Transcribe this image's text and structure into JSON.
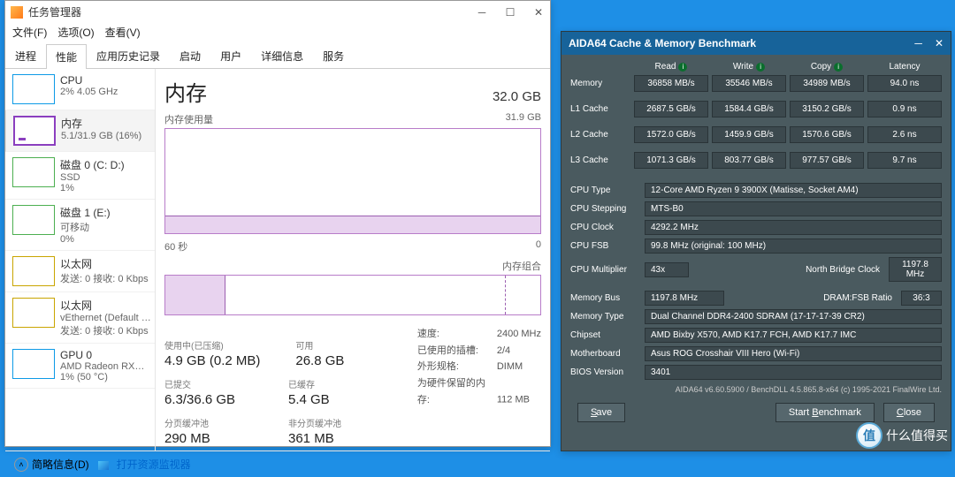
{
  "taskmgr": {
    "title": "任务管理器",
    "menu": [
      "文件(F)",
      "选项(O)",
      "查看(V)"
    ],
    "tabs": [
      "进程",
      "性能",
      "应用历史记录",
      "启动",
      "用户",
      "详细信息",
      "服务"
    ],
    "activeTab": 1,
    "sidebar": [
      {
        "name": "CPU",
        "sub": "2%  4.05 GHz"
      },
      {
        "name": "内存",
        "sub": "5.1/31.9 GB (16%)"
      },
      {
        "name": "磁盘 0 (C: D:)",
        "sub": "SSD",
        "sub2": "1%"
      },
      {
        "name": "磁盘 1 (E:)",
        "sub": "可移动",
        "sub2": "0%"
      },
      {
        "name": "以太网",
        "sub": "发送: 0  接收: 0 Kbps"
      },
      {
        "name": "以太网",
        "sub": "vEthernet (Default …",
        "sub2": "发送: 0  接收: 0 Kbps"
      },
      {
        "name": "GPU 0",
        "sub": "AMD Radeon RX…",
        "sub2": "1% (50 °C)"
      }
    ],
    "main": {
      "title": "内存",
      "capacity": "32.0 GB",
      "chart1Label": "内存使用量",
      "chart1Max": "31.9 GB",
      "chart1XLabel": "60 秒",
      "chart1XRight": "0",
      "chart2Label": "内存组合",
      "stats": [
        {
          "k": "使用中(已压缩)",
          "v": "4.9 GB (0.2 MB)"
        },
        {
          "k": "可用",
          "v": "26.8 GB"
        },
        {
          "k": "已提交",
          "v": "6.3/36.6 GB"
        },
        {
          "k": "已缓存",
          "v": "5.4 GB"
        },
        {
          "k": "分页缓冲池",
          "v": "290 MB"
        },
        {
          "k": "非分页缓冲池",
          "v": "361 MB"
        }
      ],
      "kvs": [
        {
          "k": "速度:",
          "v": "2400 MHz"
        },
        {
          "k": "已使用的插槽:",
          "v": "2/4"
        },
        {
          "k": "外形规格:",
          "v": "DIMM"
        },
        {
          "k": "为硬件保留的内存:",
          "v": "112 MB"
        }
      ]
    },
    "footer": {
      "brief": "简略信息(D)",
      "link": "打开资源监视器"
    }
  },
  "aida": {
    "title": "AIDA64 Cache & Memory Benchmark",
    "headers": [
      "Read",
      "Write",
      "Copy",
      "Latency"
    ],
    "rows": [
      {
        "label": "Memory",
        "cells": [
          "36858 MB/s",
          "35546 MB/s",
          "34989 MB/s",
          "94.0 ns"
        ]
      },
      {
        "label": "L1 Cache",
        "cells": [
          "2687.5 GB/s",
          "1584.4 GB/s",
          "3150.2 GB/s",
          "0.9 ns"
        ]
      },
      {
        "label": "L2 Cache",
        "cells": [
          "1572.0 GB/s",
          "1459.9 GB/s",
          "1570.6 GB/s",
          "2.6 ns"
        ]
      },
      {
        "label": "L3 Cache",
        "cells": [
          "1071.3 GB/s",
          "803.77 GB/s",
          "977.57 GB/s",
          "9.7 ns"
        ]
      }
    ],
    "info": [
      {
        "k": "CPU Type",
        "v": "12-Core AMD Ryzen 9 3900X  (Matisse, Socket AM4)"
      },
      {
        "k": "CPU Stepping",
        "v": "MTS-B0"
      },
      {
        "k": "CPU Clock",
        "v": "4292.2 MHz"
      },
      {
        "k": "CPU FSB",
        "v": "99.8 MHz  (original: 100 MHz)"
      },
      {
        "k": "CPU Multiplier",
        "v": "43x",
        "k2": "North Bridge Clock",
        "v2": "1197.8 MHz"
      }
    ],
    "info2": [
      {
        "k": "Memory Bus",
        "v": "1197.8 MHz",
        "k2": "DRAM:FSB Ratio",
        "v2": "36:3"
      },
      {
        "k": "Memory Type",
        "v": "Dual Channel DDR4-2400 SDRAM  (17-17-17-39 CR2)"
      },
      {
        "k": "Chipset",
        "v": "AMD Bixby X570, AMD K17.7 FCH, AMD K17.7 IMC"
      },
      {
        "k": "Motherboard",
        "v": "Asus ROG Crosshair VIII Hero (Wi-Fi)"
      },
      {
        "k": "BIOS Version",
        "v": "3401"
      }
    ],
    "footLine": "AIDA64 v6.60.5900 / BenchDLL 4.5.865.8-x64  (c) 1995-2021 FinalWire Ltd.",
    "buttons": {
      "save": "Save",
      "start": "Start Benchmark",
      "close": "Close"
    }
  },
  "watermark": "什么值得买"
}
